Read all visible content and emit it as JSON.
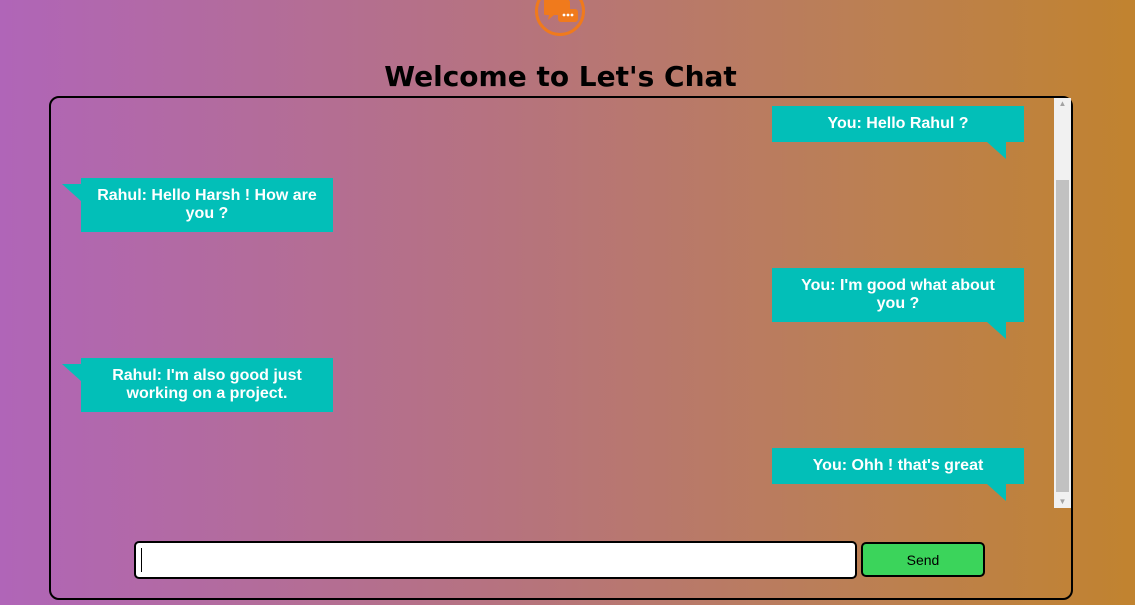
{
  "header": {
    "logo_icon": "chat-bubbles-icon",
    "title": "Welcome to Let's Chat"
  },
  "messages": [
    {
      "side": "right",
      "text": "You: Hello Rahul ?"
    },
    {
      "side": "left",
      "text": "Rahul: Hello Harsh ! How are you ?"
    },
    {
      "side": "right",
      "text": "You: I'm good what about you ?"
    },
    {
      "side": "left",
      "text": "Rahul: I'm also good just working on a project."
    },
    {
      "side": "right",
      "text": "You: Ohh ! that's great"
    }
  ],
  "composer": {
    "input_value": "",
    "input_placeholder": "",
    "send_label": "Send"
  },
  "colors": {
    "bubble": "#02bfb8",
    "send_button": "#3bd45b",
    "logo": "#f07a1c"
  }
}
